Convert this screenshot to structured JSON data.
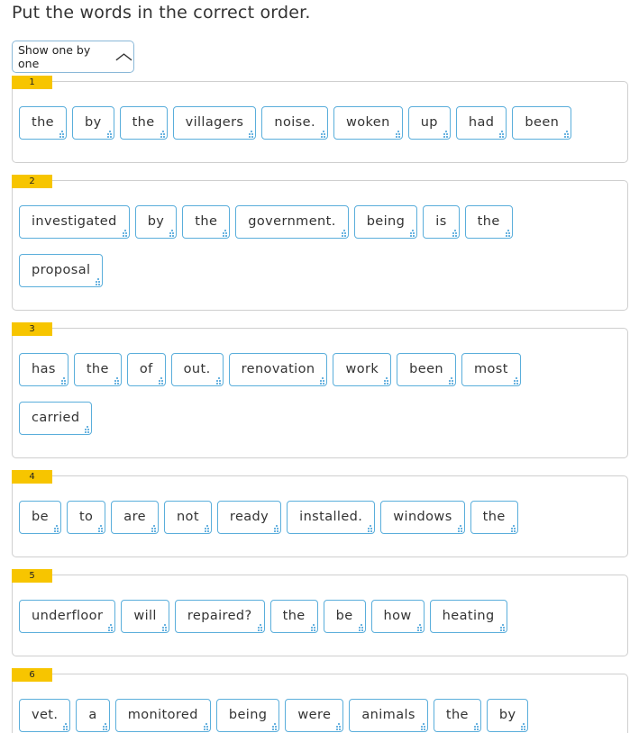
{
  "instruction": "Put the words in the correct order.",
  "toggle": {
    "label": "Show one by one"
  },
  "exercises": [
    {
      "number": "1",
      "rows": [
        [
          "the",
          "by",
          "the",
          "villagers",
          "noise.",
          "woken",
          "up",
          "had",
          "been"
        ]
      ]
    },
    {
      "number": "2",
      "rows": [
        [
          "investigated",
          "by",
          "the",
          "government.",
          "being",
          "is",
          "the"
        ],
        [
          "proposal"
        ]
      ]
    },
    {
      "number": "3",
      "rows": [
        [
          "has",
          "the",
          "of",
          "out.",
          "renovation",
          "work",
          "been",
          "most"
        ],
        [
          "carried"
        ]
      ]
    },
    {
      "number": "4",
      "rows": [
        [
          "be",
          "to",
          "are",
          "not",
          "ready",
          "installed.",
          "windows",
          "the"
        ]
      ]
    },
    {
      "number": "5",
      "rows": [
        [
          "underfloor",
          "will",
          "repaired?",
          "the",
          "be",
          "how",
          "heating"
        ]
      ]
    },
    {
      "number": "6",
      "rows": [
        [
          "vet.",
          "a",
          "monitored",
          "being",
          "were",
          "animals",
          "the",
          "by"
        ]
      ]
    }
  ]
}
